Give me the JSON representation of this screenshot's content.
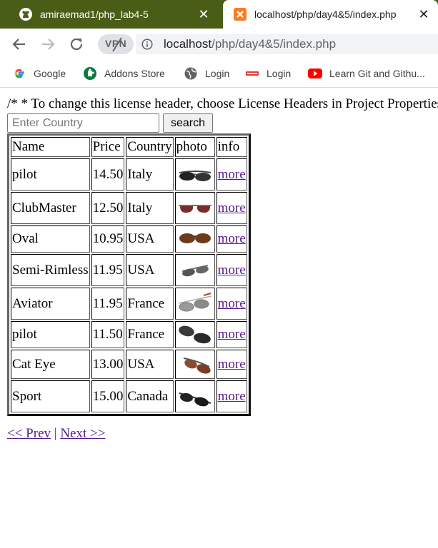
{
  "browser": {
    "tabs": [
      {
        "title": "amiraemad1/php_lab4-5",
        "icon": "github-icon",
        "active": false
      },
      {
        "title": "localhost/php/day4&5/index.php",
        "icon": "xampp-icon",
        "active": true
      }
    ],
    "tab_strip_color": "#4a5d17",
    "vpn_label": "VPN",
    "url_host": "localhost",
    "url_path": "/php/day4&5/index.php",
    "bookmarks": [
      {
        "label": "Google",
        "icon": "google-icon"
      },
      {
        "label": "Addons Store",
        "icon": "puzzle-icon"
      },
      {
        "label": "Login",
        "icon": "globe-icon"
      },
      {
        "label": "Login",
        "icon": "site-logo-icon"
      },
      {
        "label": "Learn Git and Githu...",
        "icon": "youtube-icon"
      }
    ]
  },
  "page": {
    "comment": "/* * To change this license header, choose License Headers in Project Properties.",
    "search": {
      "placeholder": "Enter Country",
      "value": "",
      "button_label": "search"
    },
    "table": {
      "headers": [
        "Name",
        "Price",
        "Country",
        "photo",
        "info"
      ],
      "rows": [
        {
          "name": "pilot",
          "price": "14.50",
          "country": "Italy",
          "info": "more"
        },
        {
          "name": "ClubMaster",
          "price": "12.50",
          "country": "Italy",
          "info": "more"
        },
        {
          "name": "Oval",
          "price": "10.95",
          "country": "USA",
          "info": "more"
        },
        {
          "name": "Semi-Rimless",
          "price": "11.95",
          "country": "USA",
          "info": "more"
        },
        {
          "name": "Aviator",
          "price": "11.95",
          "country": "France",
          "info": "more"
        },
        {
          "name": "pilot",
          "price": "11.50",
          "country": "France",
          "info": "more"
        },
        {
          "name": "Cat Eye",
          "price": "13.00",
          "country": "USA",
          "info": "more"
        },
        {
          "name": "Sport",
          "price": "15.00",
          "country": "Canada",
          "info": "more"
        }
      ]
    },
    "pager": {
      "prev": "<< Prev",
      "separator": "|",
      "next": "Next >>"
    },
    "link_color": "#551a8b"
  }
}
